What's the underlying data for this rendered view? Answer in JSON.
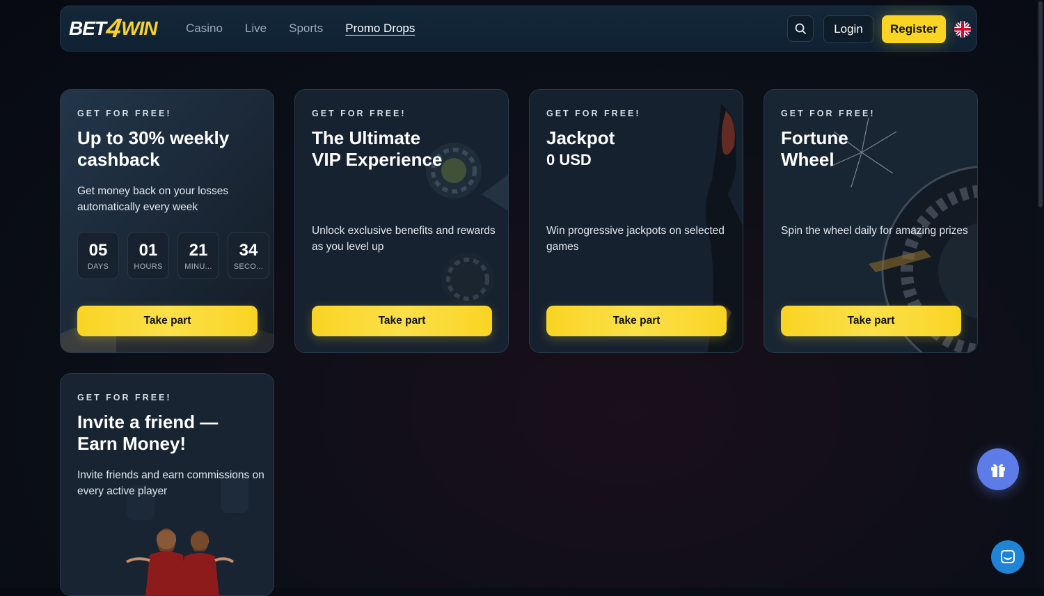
{
  "brand": {
    "logo_part1": "BET",
    "logo_part2": "4",
    "logo_part3": "WIN"
  },
  "nav": {
    "items": [
      {
        "label": "Casino",
        "active": false
      },
      {
        "label": "Live",
        "active": false
      },
      {
        "label": "Sports",
        "active": false
      },
      {
        "label": "Promo Drops",
        "active": true
      }
    ]
  },
  "header": {
    "login_label": "Login",
    "register_label": "Register",
    "language_icon": "uk-flag-icon",
    "search_icon": "search-icon"
  },
  "promos": [
    {
      "tag": "GET FOR FREE!",
      "title": "Up to 30% weekly cashback",
      "description": "Get money back on your losses automatically every week",
      "countdown": [
        {
          "value": "05",
          "label": "DAYS"
        },
        {
          "value": "01",
          "label": "HOURS"
        },
        {
          "value": "21",
          "label": "MINU..."
        },
        {
          "value": "34",
          "label": "SECO..."
        }
      ],
      "cta": "Take part"
    },
    {
      "tag": "GET FOR FREE!",
      "title_line1": "The Ultimate",
      "title_line2": "VIP Experience",
      "description": "Unlock exclusive benefits and rewards as you level up",
      "cta": "Take part"
    },
    {
      "tag": "GET FOR FREE!",
      "title_line1": "Jackpot",
      "title_line2": "0 USD",
      "description": "Win progressive jackpots on selected games",
      "cta": "Take part"
    },
    {
      "tag": "GET FOR FREE!",
      "title_line1": "Fortune",
      "title_line2": "Wheel",
      "description": "Spin the wheel daily for amazing prizes",
      "cta": "Take part"
    },
    {
      "tag": "GET FOR FREE!",
      "title_line1": "Invite a friend —",
      "title_line2": "Earn Money!",
      "description": "Invite friends and earn commissions on every active player"
    }
  ],
  "floating": {
    "gift_icon": "gift-icon",
    "chat_icon": "chat-icon"
  },
  "colors": {
    "accent": "#f9d423",
    "gift_button": "#5d7ce8",
    "chat_button": "#1f84d6",
    "background": "#0b0f18"
  }
}
